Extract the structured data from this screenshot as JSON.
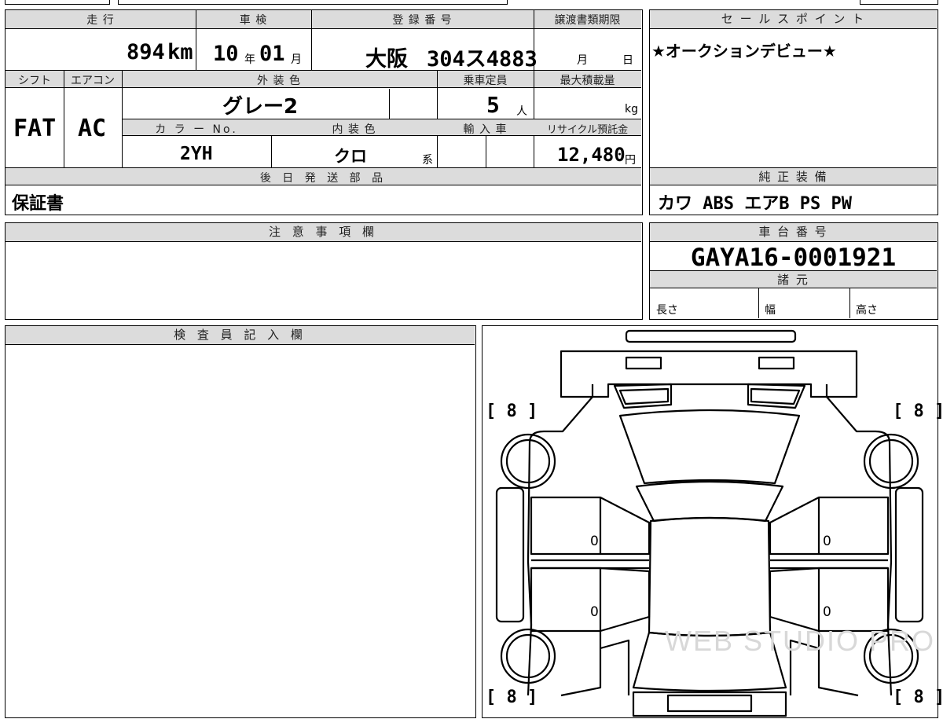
{
  "top_table": {
    "mileage_label": "走 行",
    "mileage_value": "894",
    "mileage_unit": "km",
    "inspection_label": "車 検",
    "inspection_year": "10",
    "inspection_year_unit": "年",
    "inspection_month": "01",
    "inspection_month_unit": "月",
    "registration_label": "登 録 番 号",
    "registration_region": "大阪",
    "registration_number": "304ス4883",
    "transfer_deadline_label": "譲渡書類期限",
    "transfer_month_unit": "月",
    "transfer_day_unit": "日",
    "shift_label": "シフト",
    "shift_value": "FAT",
    "aircon_label": "エアコン",
    "aircon_value": "AC",
    "exterior_color_label": "外 装 色",
    "exterior_color_value": "グレー2",
    "capacity_label": "乗車定員",
    "capacity_value": "5",
    "capacity_unit": "人",
    "max_load_label": "最大積載量",
    "max_load_unit": "kg",
    "color_no_label": "カ ラ ー No.",
    "color_no_value": "2YH",
    "interior_color_label": "内 装 色",
    "interior_color_value": "クロ",
    "interior_color_suffix": "系",
    "import_label": "輸 入 車",
    "recycle_label": "リサイクル預託金",
    "recycle_value": "12,480",
    "recycle_unit": "円",
    "later_parts_label": "後 日 発 送 部 品",
    "later_parts_value": "保証書"
  },
  "sales_point": {
    "label": "セ ー ル ス ポ イ ン ト",
    "value": "★オークションデビュー★"
  },
  "standard_equipment": {
    "label": "純 正 装 備",
    "value": "カワ ABS エアB PS PW"
  },
  "notes": {
    "label": "注 意 事 項 欄"
  },
  "chassis": {
    "label": "車 台 番 号",
    "value": "GAYA16-0001921",
    "specs_label": "諸 元",
    "length_label": "長さ",
    "width_label": "幅",
    "height_label": "高さ"
  },
  "inspector": {
    "label": "検 査 員 記 入 欄"
  },
  "diagram": {
    "tire_front_left": "[ 8 ]",
    "tire_front_right": "[ 8 ]",
    "tire_rear_left": "[ 8 ]",
    "tire_rear_right": "[ 8 ]",
    "door_mark_1": "0",
    "door_mark_2": "0",
    "door_mark_3": "0",
    "door_mark_4": "0",
    "watermark": "WEB STUDIO PRO"
  }
}
